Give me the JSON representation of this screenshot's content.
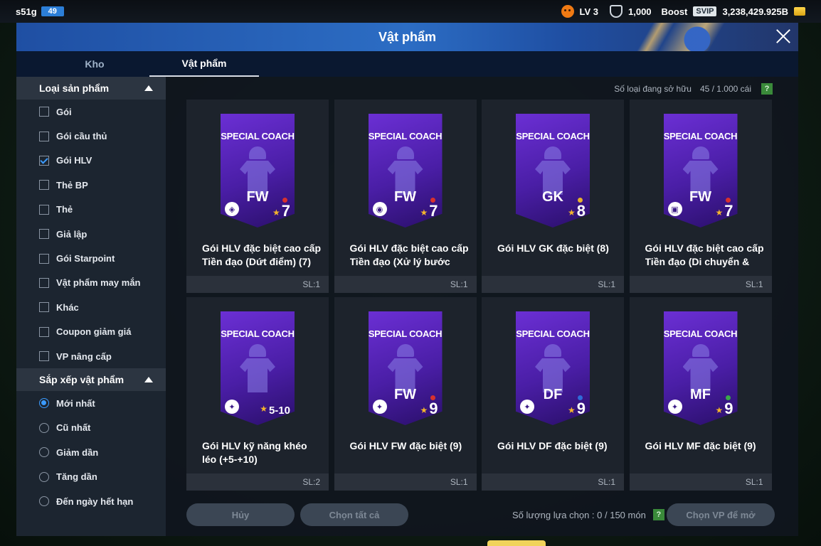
{
  "topbar": {
    "username": "s51g",
    "level_badge": "49",
    "player_level": "LV 3",
    "shield_count": "1,000",
    "boost_label": "Boost",
    "svip_label": "SVIP",
    "bp_balance": "3,238,429.925B"
  },
  "modal": {
    "title": "Vật phẩm"
  },
  "tabs": [
    {
      "label": "Kho",
      "active": false
    },
    {
      "label": "Vật phẩm",
      "active": true
    }
  ],
  "sidebar": {
    "category_header": "Loại sản phẩm",
    "filters": [
      {
        "label": "Gói",
        "checked": false
      },
      {
        "label": "Gói cầu thủ",
        "checked": false
      },
      {
        "label": "Gói HLV",
        "checked": true
      },
      {
        "label": "Thẻ BP",
        "checked": false
      },
      {
        "label": "Thẻ",
        "checked": false
      },
      {
        "label": "Giả lập",
        "checked": false
      },
      {
        "label": "Gói Starpoint",
        "checked": false
      },
      {
        "label": "Vật phẩm may mắn",
        "checked": false
      },
      {
        "label": "Khác",
        "checked": false
      },
      {
        "label": "Coupon giảm giá",
        "checked": false
      },
      {
        "label": "VP nâng cấp",
        "checked": false
      }
    ],
    "sort_header": "Sắp xếp vật phẩm",
    "sorts": [
      {
        "label": "Mới nhất",
        "selected": true
      },
      {
        "label": "Cũ nhất",
        "selected": false
      },
      {
        "label": "Giảm dần",
        "selected": false
      },
      {
        "label": "Tăng dần",
        "selected": false
      },
      {
        "label": "Đến ngày hết hạn",
        "selected": false
      }
    ]
  },
  "owned": {
    "label": "Số loại đang sở hữu",
    "value": "45 / 1.000 cái",
    "help": "?"
  },
  "cards": [
    {
      "banner": "SPECIAL COACH",
      "position": "FW",
      "level": "7",
      "dot_color": "#d8312e",
      "badge_icon": "shield-icon",
      "name": "Gói HLV đặc biệt cao cấp Tiền đạo (Dứt điểm) (7)",
      "qty": "SL:1"
    },
    {
      "banner": "SPECIAL COACH",
      "position": "FW",
      "level": "7",
      "dot_color": "#d8312e",
      "badge_icon": "dribble-icon",
      "name": "Gói HLV đặc biệt cao cấp Tiền đạo (Xử lý bước",
      "qty": "SL:1"
    },
    {
      "banner": "SPECIAL COACH",
      "position": "GK",
      "level": "8",
      "dot_color": "#e6b12c",
      "badge_icon": "",
      "name": "Gói HLV GK đặc biệt (8)",
      "qty": "SL:1"
    },
    {
      "banner": "SPECIAL COACH",
      "position": "FW",
      "level": "7",
      "dot_color": "#d8312e",
      "badge_icon": "lock-icon",
      "name": "Gói HLV đặc biệt cao cấp Tiền đạo (Di chuyển & tìm",
      "qty": "SL:1"
    },
    {
      "banner": "SPECIAL COACH",
      "position": "",
      "level": "5-10",
      "dot_color": "",
      "badge_icon": "emblem-icon",
      "name": "Gói HLV kỹ năng khéo léo (+5-+10)",
      "qty": "SL:2"
    },
    {
      "banner": "SPECIAL COACH",
      "position": "FW",
      "level": "9",
      "dot_color": "#d8312e",
      "badge_icon": "emblem-icon",
      "name": "Gói HLV FW đặc biệt (9)",
      "qty": "SL:1"
    },
    {
      "banner": "SPECIAL COACH",
      "position": "DF",
      "level": "9",
      "dot_color": "#2f6bd8",
      "badge_icon": "emblem-icon",
      "name": "Gói HLV DF đặc biệt (9)",
      "qty": "SL:1"
    },
    {
      "banner": "SPECIAL COACH",
      "position": "MF",
      "level": "9",
      "dot_color": "#3aa84a",
      "badge_icon": "emblem-icon",
      "name": "Gói HLV MF đặc biệt (9)",
      "qty": "SL:1"
    }
  ],
  "bottom": {
    "cancel_label": "Hủy",
    "select_all_label": "Chọn tất cả",
    "selection_label": "Số lượng lựa chọn : 0 / 150 món",
    "help": "?",
    "open_label": "Chọn VP để mở"
  },
  "colors": {
    "accent": "#3b9bff",
    "header_blue": "#2c6dc4",
    "card_purple": "#5a23c0"
  }
}
